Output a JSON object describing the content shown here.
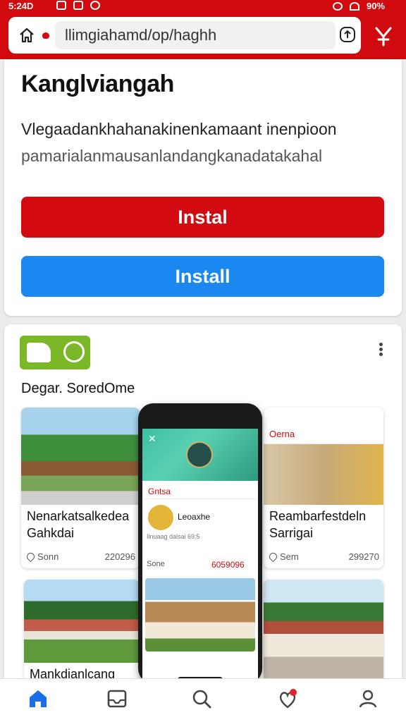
{
  "status_bar": {
    "time": "5:24D",
    "battery": "90%"
  },
  "browser": {
    "url": "llimgiahamd/op/haghh"
  },
  "install_card": {
    "title": "Kanglviangah",
    "description_line1": "Vlegaadankhahanakinenkamaant inenpioon",
    "description_line2": "pamarialanmausanlandangkanadatakahal",
    "primary_button": "Instal",
    "secondary_button": "Install"
  },
  "feed": {
    "section_title": "Degar. SoredOme",
    "tiles": [
      {
        "name": "Nenarkatsalkedea Gahkdai",
        "meta": "Sonn",
        "count": "220296"
      },
      {
        "name": "Reambarfestdeln Sarrigai",
        "meta": "Sem",
        "count": "299270"
      },
      {
        "name": "Mankdianlcang"
      }
    ],
    "phone": {
      "bar_title": "Gntsa",
      "post_name": "Leoaxhe",
      "post_time": "Ilnuaag dalsai 69:5",
      "likes_label": "Sone",
      "likes_count": "6059096"
    },
    "right_tile_header": "Oerna"
  },
  "colors": {
    "brand_red": "#d10a0f",
    "install_blue": "#1a88f0",
    "logo_green": "#7ab827"
  },
  "nav": [
    "home-icon",
    "inbox-icon",
    "search-icon",
    "notifications-icon",
    "profile-icon"
  ]
}
